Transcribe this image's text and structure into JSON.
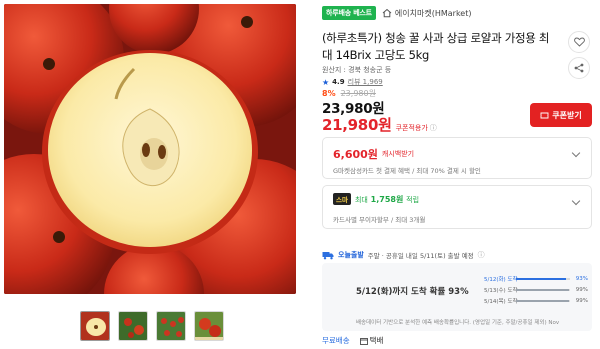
{
  "gallery": {
    "main_image_alt": "apple cut in half on apples",
    "thumbnails": [
      {
        "name": "thumb-cut-apple"
      },
      {
        "name": "thumb-apple-tree"
      },
      {
        "name": "thumb-orchard"
      },
      {
        "name": "thumb-apples-box"
      }
    ]
  },
  "product": {
    "best_badge": "하루배송 베스트",
    "store": "에이치마켓(HMarket)",
    "title": "(하루초특가) 청송 꿀 사과 상급 로얄과 가정용 최대 14Brix 고당도 5kg",
    "origin": "원산지 : 경북 청송군 등",
    "rating": "4.9",
    "reviews": "리뷰 1,969",
    "discount_pct": "8%",
    "original_price": "23,980원",
    "sale_price": "23,980원",
    "coupon_price": "21,980원",
    "coupon_note": "쿠폰적용가",
    "coupon_button": "쿠폰받기"
  },
  "cashback": {
    "amount": "6,600원",
    "label": "캐시백받기",
    "detail": "G마켓삼성카드 첫 결제 혜택 / 최대 70% 결제 시 할인"
  },
  "smile": {
    "badge": "스마",
    "points_prefix": "최대",
    "points": "1,758원",
    "points_suffix": "적립",
    "installment": "카드사별 무이자할부 / 최대 3개월"
  },
  "delivery": {
    "tag": "오늘출발",
    "text": "주말 · 공휴일 내일 5/11(토) 출발 예정",
    "headline": "5/12(화)까지 도착 확률 93%",
    "rows": [
      {
        "date": "5/12(화) 도착",
        "pct": "93%",
        "fill": 0.93
      },
      {
        "date": "5/13(수) 도착",
        "pct": "99%",
        "fill": 0.99
      },
      {
        "date": "5/14(목) 도착",
        "pct": "99%",
        "fill": 0.99
      }
    ],
    "footnote": "배송데이터 기반으로 분석한 예측 배송확률입니다. (영업일 기준, 주말/공휴일 제외) Nov"
  },
  "shipping_tabs": {
    "free": "무료배송",
    "parcel": "택배"
  },
  "colors": {
    "accent_red": "#e3242b",
    "best_green": "#1fb34f",
    "delivery_blue": "#2b6fe0"
  }
}
